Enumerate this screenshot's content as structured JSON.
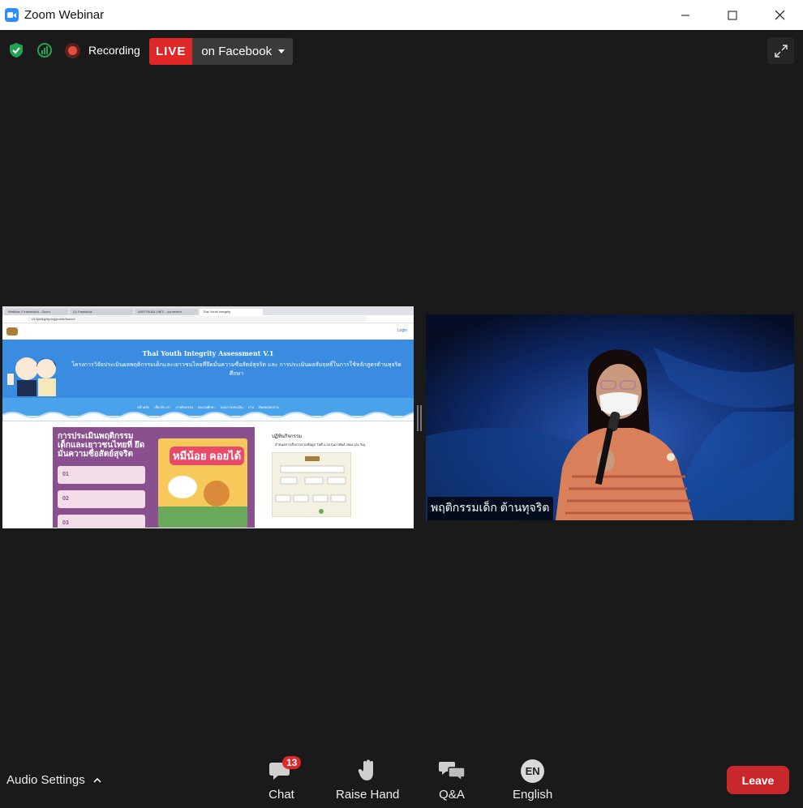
{
  "window": {
    "title": "Zoom Webinar",
    "controls": [
      "minimize-icon",
      "maximize-icon",
      "close-icon"
    ]
  },
  "topbar": {
    "recording_label": "Recording",
    "live_label": "LIVE",
    "live_destination": "on Facebook"
  },
  "shared_screen": {
    "browser_tabs": [
      "Webinar 2 Interaction - Zoom",
      "(1) Facebook",
      "เอกสารแนบ | NEC - yourevent",
      "Thai Youth Integrity"
    ],
    "url": "v1.fyintegrity.org/public/home1",
    "login_label": "Login",
    "banner_title": "Thai Youth Integrity Assessment V.1",
    "banner_subtitle": "โครงการวิจัยประเมินผลพฤติกรรมเด็กและเยาวชนไทยที่ยึดมั่นความซื่อสัตย์สุจริต และ การประเมินผลสัมฤทธิ์ในการใช้หลักสูตรต้านทุจริตศึกษา",
    "nav_items": [
      "หน้าหลัก",
      "เกี่ยวกับ เรา",
      "ภาพกิจกรรม",
      "ผลงานศึกษา",
      "แบบการประเมิน",
      "ถาม",
      "ติดต่อสอบถาม"
    ],
    "poster_title": "การประเมินพฤติกรรม เด็กและเยาวชนไทยที่ ยึดมั่นความซื่อสัตย์สุจริต",
    "poster_items": [
      "01",
      "02",
      "03"
    ],
    "book_title": "หมีน้อย คอยได้",
    "calendar_title": "ปฏิทินกิจกรรม",
    "calendar_items": [
      "ลำหนดการเก็บรวบรวมข้อมูล วันที่ 4-28 กุมภาพันธ์ 2564 (24 วัน)"
    ]
  },
  "video": {
    "participant_name": "พฤติกรรมเด็ก ต้านทุจริต"
  },
  "bottombar": {
    "audio_settings": "Audio Settings",
    "chat_label": "Chat",
    "chat_badge": "13",
    "raise_hand_label": "Raise Hand",
    "qa_label": "Q&A",
    "language_code": "EN",
    "language_label": "English",
    "leave_label": "Leave"
  },
  "colors": {
    "background": "#1a1a1a",
    "live_red": "#e02828",
    "leave_red": "#c8282c",
    "secure_green": "#23a452"
  }
}
